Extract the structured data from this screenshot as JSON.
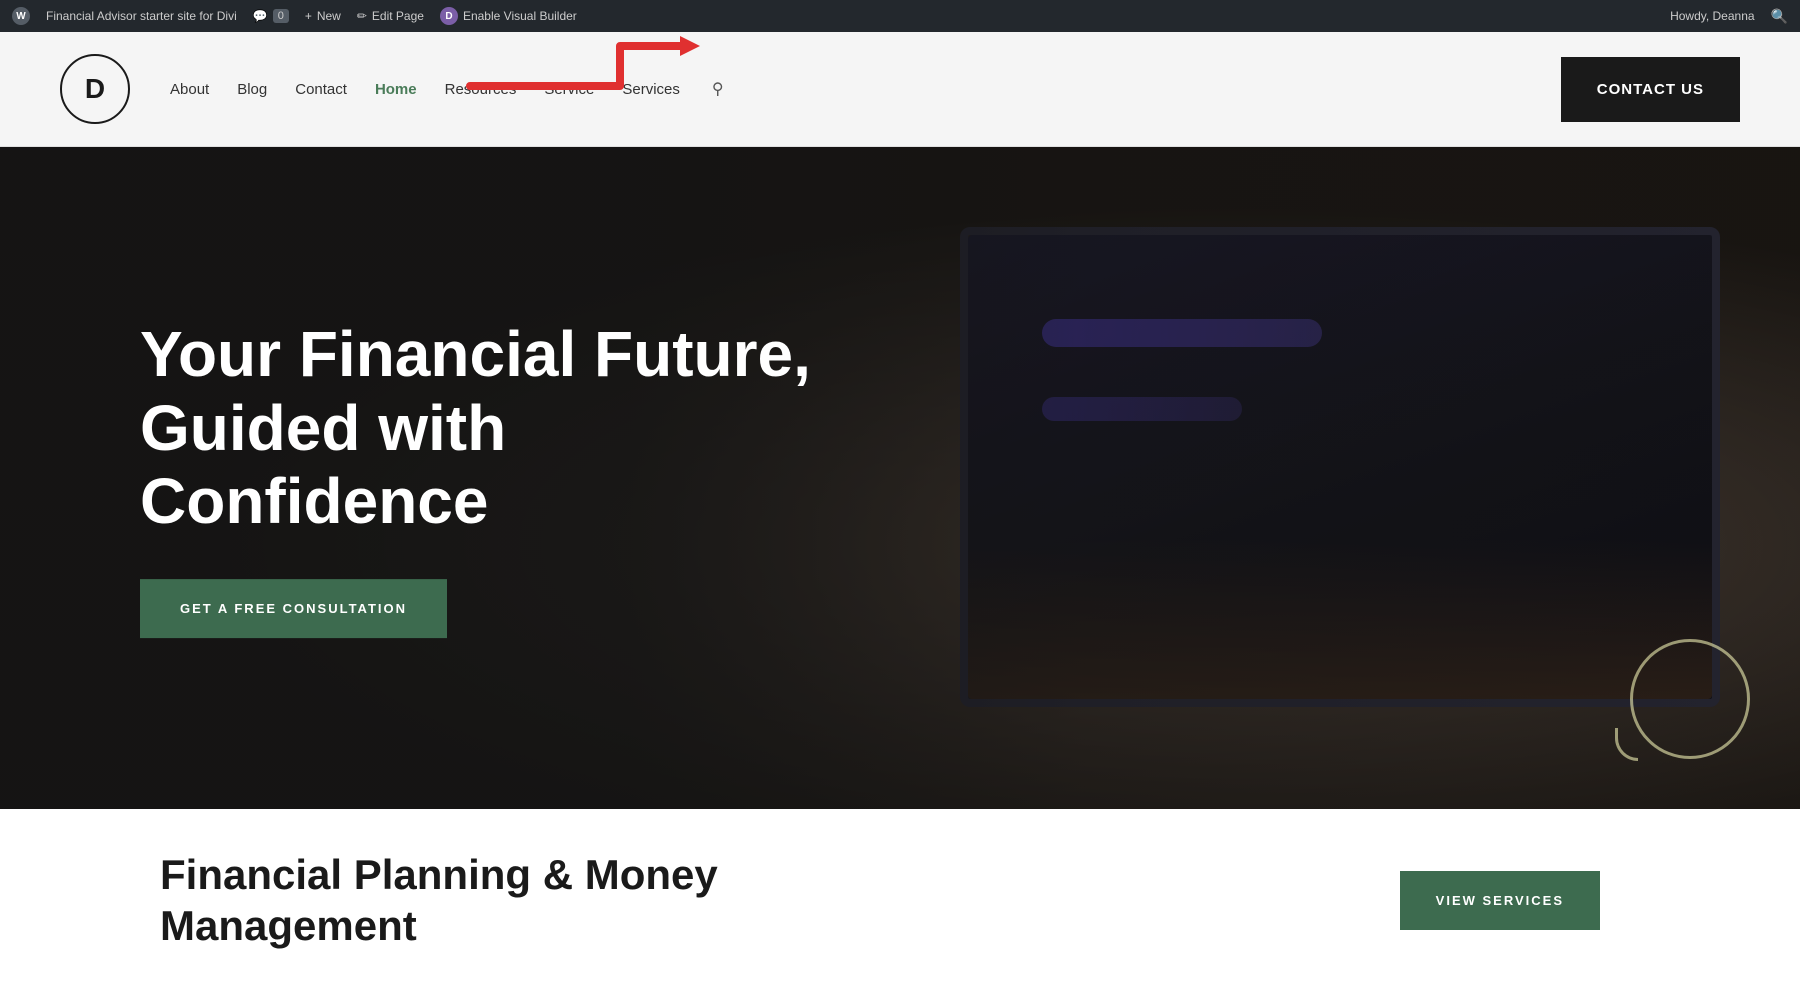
{
  "admin_bar": {
    "site_title": "Financial Advisor starter site for Divi",
    "wp_icon_label": "W",
    "comments_label": "0",
    "new_label": "New",
    "edit_label": "Edit Page",
    "divi_label": "D",
    "enable_visual_builder": "Enable Visual Builder",
    "howdy_text": "Howdy, Deanna",
    "search_icon": "⌕"
  },
  "header": {
    "logo_letter": "D",
    "nav_items": [
      {
        "label": "About",
        "active": false
      },
      {
        "label": "Blog",
        "active": false
      },
      {
        "label": "Contact",
        "active": false
      },
      {
        "label": "Home",
        "active": true
      },
      {
        "label": "Resources",
        "active": false
      },
      {
        "label": "Service",
        "active": false
      },
      {
        "label": "Services",
        "active": false
      }
    ],
    "contact_button": "CONTACT US"
  },
  "hero": {
    "title": "Your Financial Future, Guided with Confidence",
    "cta_button": "GET A FREE CONSULTATION"
  },
  "bottom": {
    "title_line1": "Financial Planning & Money",
    "title_line2": "Management",
    "view_services_btn": "VIEW SERVICES"
  }
}
